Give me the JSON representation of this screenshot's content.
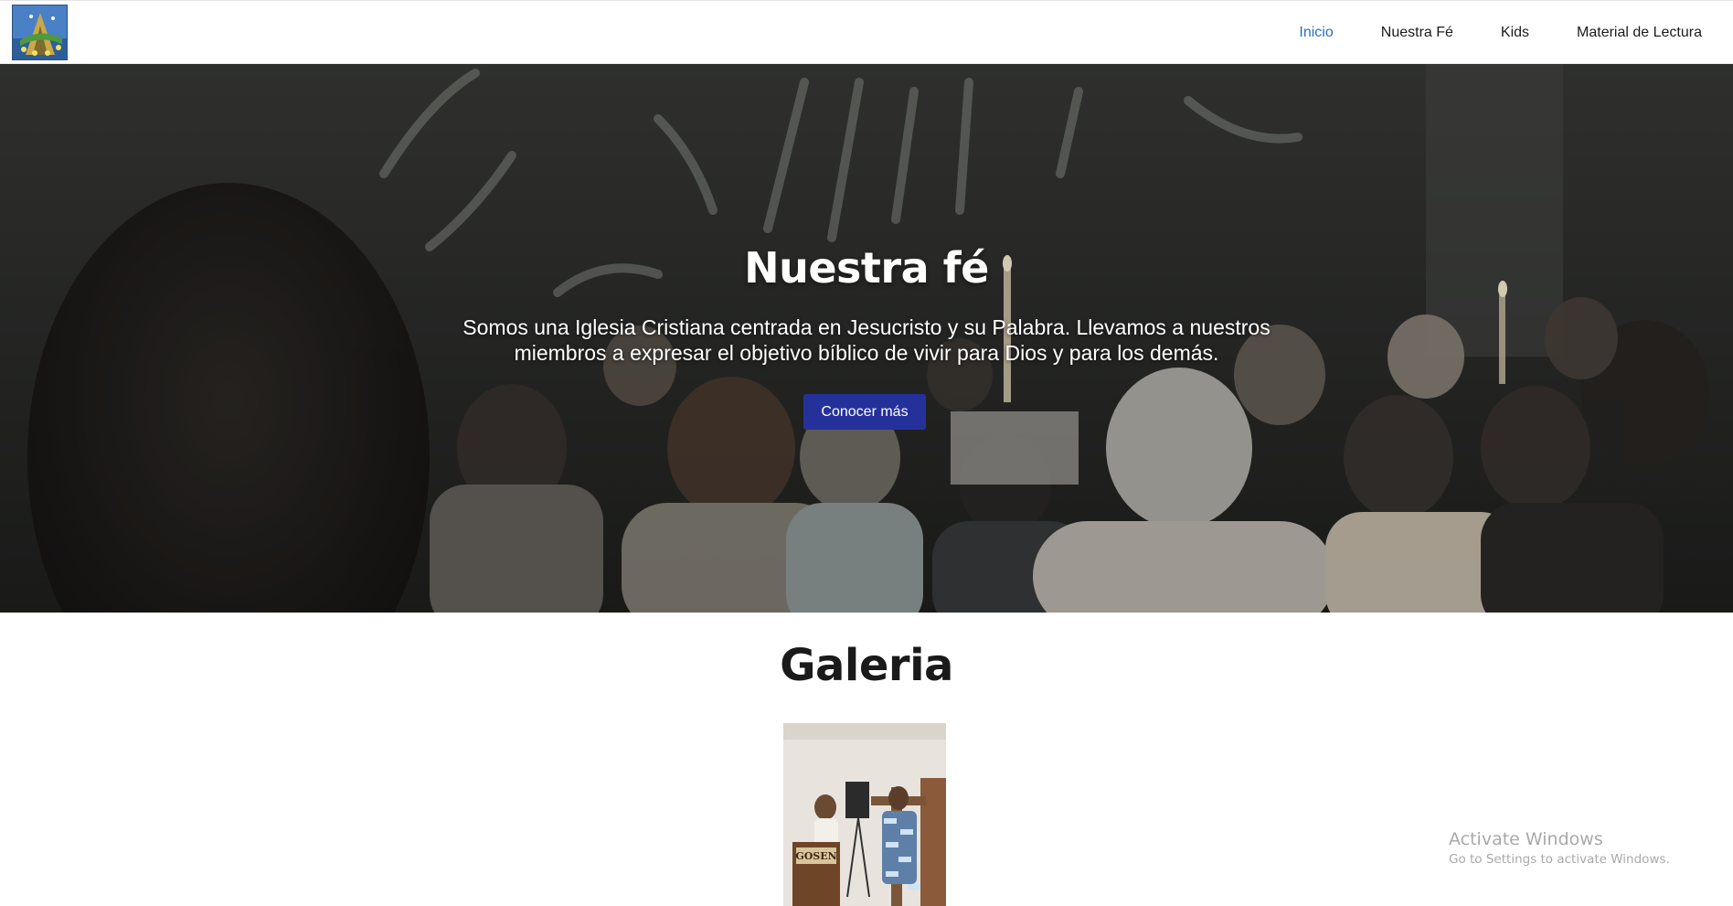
{
  "nav": {
    "logo_icon": "church-logo-icon",
    "links": [
      {
        "label": "Inicio",
        "active": true
      },
      {
        "label": "Nuestra Fé",
        "active": false
      },
      {
        "label": "Kids",
        "active": false
      },
      {
        "label": "Material de Lectura",
        "active": false
      }
    ]
  },
  "hero": {
    "title": "Nuestra fé",
    "text": "Somos una Iglesia Cristiana centrada en Jesucristo y su Palabra. Llevamos a nuestros miembros a expresar el objetivo bíblico de vivir para Dios y para los demás.",
    "button_label": "Conocer más",
    "button_color": "#25319a"
  },
  "gallery": {
    "title": "Galeria",
    "photo_sign": "GOSEN"
  },
  "watermark": {
    "title": "Activate Windows",
    "subtitle": "Go to Settings to activate Windows."
  },
  "colors": {
    "nav_active": "#2b6fc0",
    "nav_text": "#1c1c1c"
  }
}
